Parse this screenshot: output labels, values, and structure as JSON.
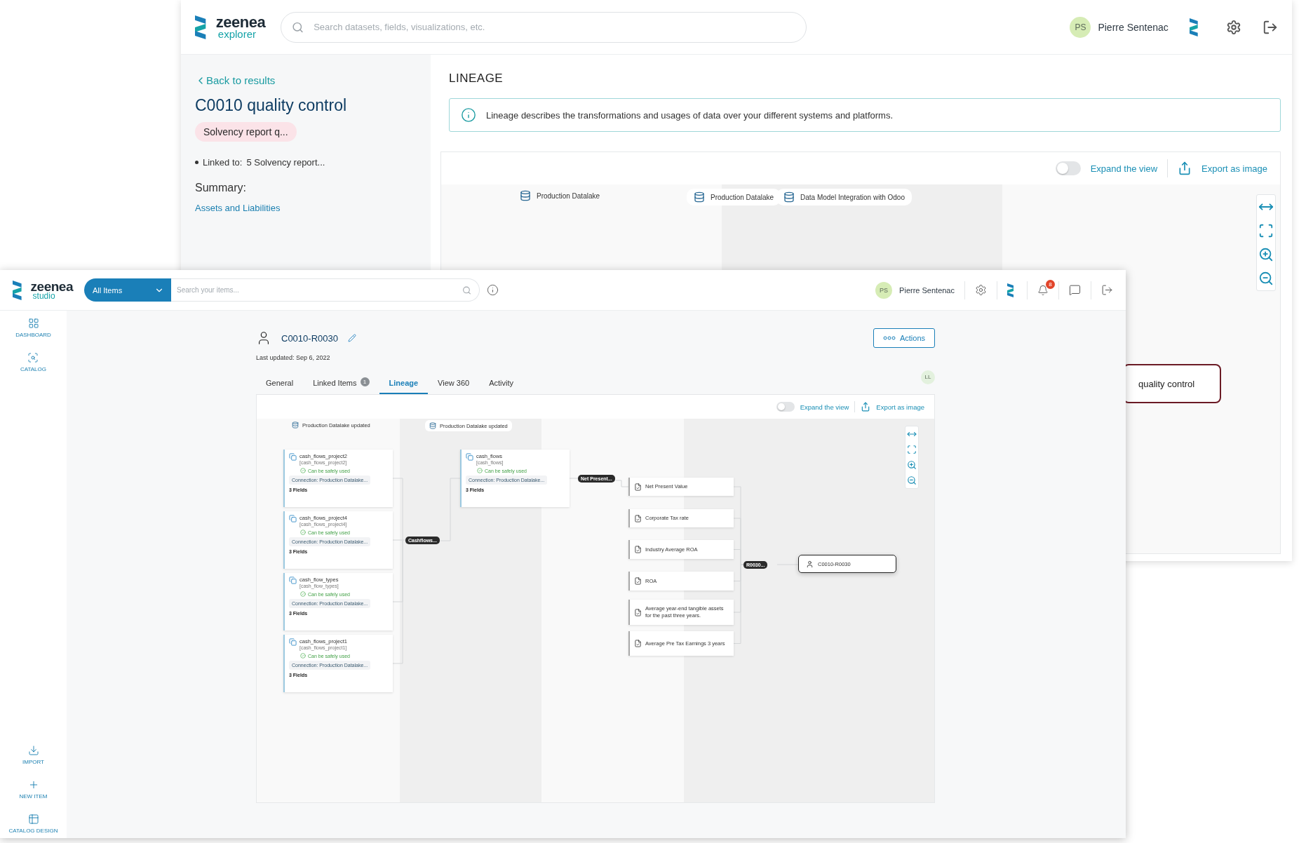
{
  "explorer": {
    "header": {
      "logo": {
        "name": "zeenea",
        "product": "explorer"
      },
      "search": {
        "placeholder": "Search datasets, fields, visualizations, etc."
      },
      "user": {
        "initials": "PS",
        "name": "Pierre Sentenac"
      }
    },
    "sidebar": {
      "back": "Back to results",
      "title": "C0010 quality control",
      "tag": "Solvency report q...",
      "linked_label": "Linked to:",
      "linked_value": "5 Solvency report...",
      "summary_label": "Summary:",
      "summary_link": "Assets and Liabilities"
    },
    "lineage": {
      "heading": "LINEAGE",
      "info": "Lineage describes the transformations and usages of data over your different systems and platforms.",
      "expand": {
        "label": "Expand the view",
        "on": false
      },
      "export": "Export as image",
      "sources": [
        {
          "label": "Production Datalake",
          "kind": "plain"
        },
        {
          "label": "Production Datalake",
          "kind": "pill"
        },
        {
          "label": "Data Model Integration with Odoo",
          "kind": "pill"
        }
      ],
      "node": "quality control"
    }
  },
  "studio": {
    "header": {
      "logo": {
        "name": "zeenea",
        "product": "studio"
      },
      "scope": "All Items",
      "search": {
        "placeholder": "Search your items..."
      },
      "user": {
        "initials": "PS",
        "name": "Pierre Sentenac"
      },
      "notifications": "8"
    },
    "sidebar": {
      "top": [
        {
          "label": "DASHBOARD",
          "kind": "dashboard"
        },
        {
          "label": "CATALOG",
          "kind": "catalog"
        }
      ],
      "bottom": [
        {
          "label": "IMPORT",
          "kind": "import"
        },
        {
          "label": "NEW ITEM",
          "kind": "new"
        },
        {
          "label": "CATALOG DESIGN",
          "kind": "design"
        }
      ]
    },
    "item": {
      "title": "C0010-R0030",
      "updated": "Last updated: Sep 6, 2022",
      "actions": "Actions",
      "reviewer": "LL",
      "tabs": [
        {
          "label": "General",
          "selected": false
        },
        {
          "label": "Linked Items",
          "badge": "1",
          "selected": false
        },
        {
          "label": "Lineage",
          "selected": true
        },
        {
          "label": "View 360",
          "selected": false
        },
        {
          "label": "Activity",
          "selected": false
        }
      ]
    },
    "lineage": {
      "expand": {
        "label": "Expand the view",
        "on": false
      },
      "export": "Export as image",
      "sources": [
        {
          "label": "Production Datalake updated",
          "kind": "plain"
        },
        {
          "label": "Production Datalake updated",
          "kind": "pill"
        }
      ],
      "datasets": [
        {
          "name": "cash_flows_project2",
          "path": "[cash_flows_project2]",
          "status": "Can be safely used",
          "connection": "Connection: Production Datalake...",
          "fields": "3 Fields"
        },
        {
          "name": "cash_flows_project4",
          "path": "[cash_flows_project4]",
          "status": "Can be safely used",
          "connection": "Connection: Production Datalake...",
          "fields": "3 Fields"
        },
        {
          "name": "cash_flow_types",
          "path": "[cash_flow_types]",
          "status": "Can be safely used",
          "connection": "Connection: Production Datalake...",
          "fields": "3 Fields"
        },
        {
          "name": "cash_flows_project1",
          "path": "[cash_flows_project1]",
          "status": "Can be safely used",
          "connection": "Connection: Production Datalake...",
          "fields": "3 Fields"
        }
      ],
      "process_1": "Cashflows...",
      "output": {
        "name": "cash_flows",
        "path": "[cash_flows]",
        "status": "Can be safely used",
        "connection": "Connection: Production Datalake...",
        "fields": "3 Fields"
      },
      "process_2": "Net Present...",
      "fields": [
        "Net Present Value",
        "Corporate Tax rate",
        "Industry Average ROA",
        "ROA",
        "Average year-end tangible assets for the past three years.",
        "Average Pre Tax Earnings 3 years"
      ],
      "process_3": "R0030...",
      "target": "C0010-R0030"
    }
  }
}
